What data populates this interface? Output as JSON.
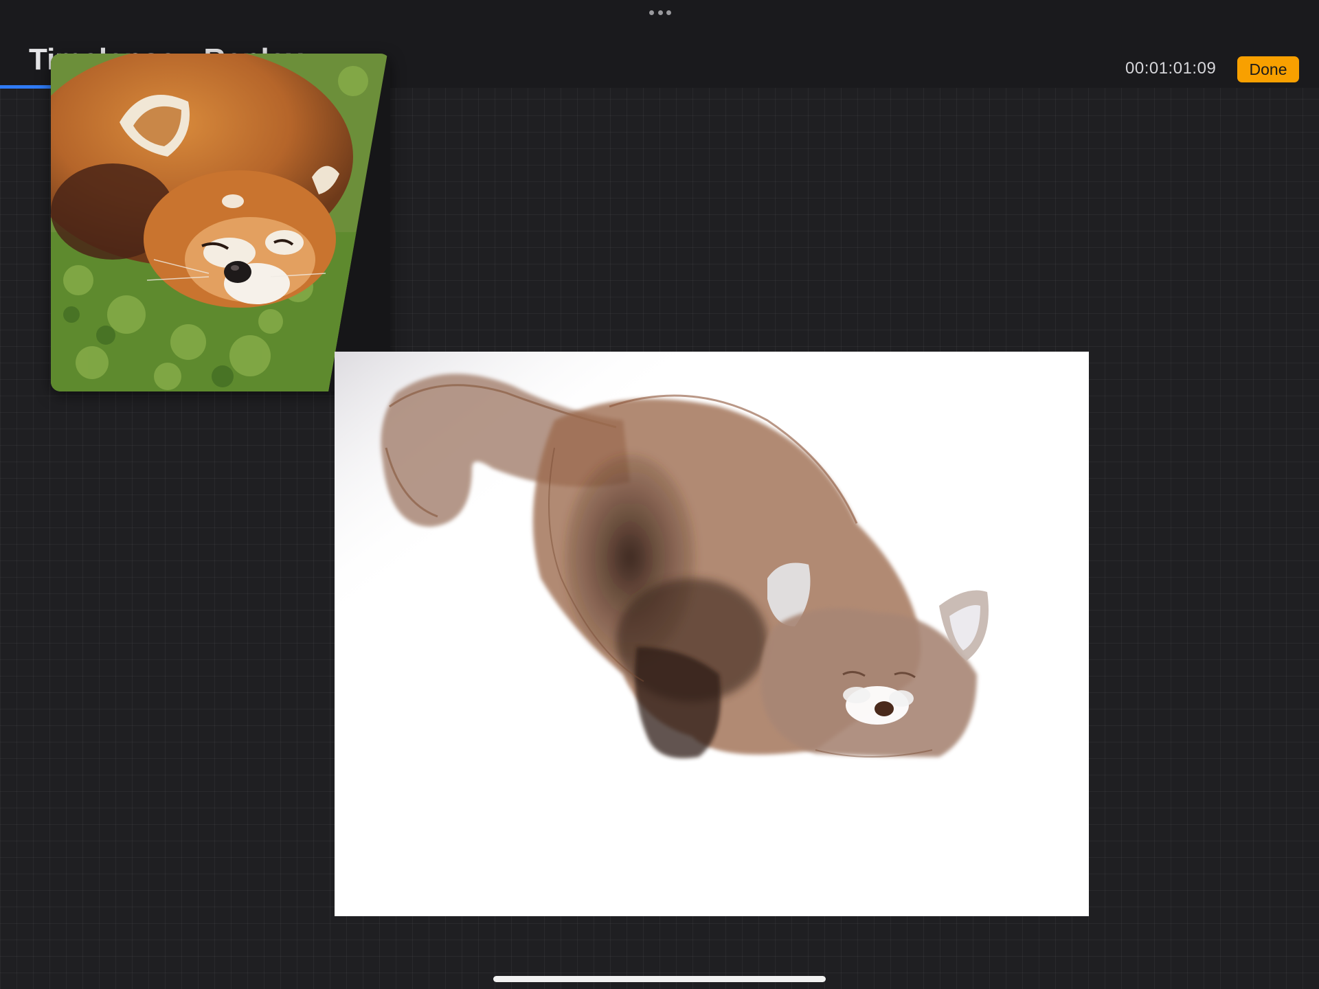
{
  "header": {
    "tabs": [
      {
        "label": "Timelapse"
      },
      {
        "label": "Replay"
      }
    ],
    "timecode": "00:01:01:09",
    "done_label": "Done"
  },
  "colors": {
    "accent": "#f8a000",
    "tab_indicator": "#2f7bf5",
    "workspace_bg": "#1f1f22"
  },
  "icons": {
    "more": "more-horizontal-icon"
  }
}
